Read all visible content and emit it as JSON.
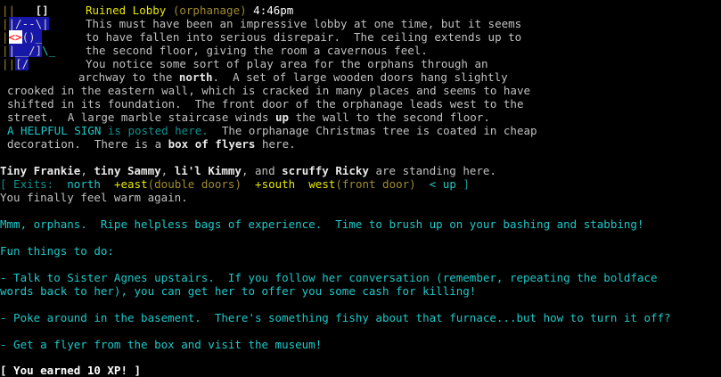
{
  "map": {
    "rows": [
      {
        "bar": "||",
        "room": "   []"
      },
      {
        "bar": "|",
        "room": "|/--\\|"
      },
      {
        "bar": "|",
        "player": "<>",
        "room": "()_"
      },
      {
        "bar": "|",
        "room": "|__/]",
        "tail": "\\_"
      },
      {
        "bar": "||",
        "room": "[/"
      }
    ],
    "colors": {
      "room_bg": "#1818a8",
      "player": "#ff3030",
      "bar": "#a08a30"
    }
  },
  "room": {
    "name": "Ruined Lobby",
    "area": "(orphanage)",
    "time": "4:46pm",
    "desc_lines": [
      [
        "This must have been an impressive lobby at one time, but it seems"
      ],
      [
        "to have fallen into serious disrepair.  The ceiling extends up to"
      ],
      [
        "the second floor, giving the room a cavernous feel."
      ],
      [
        "You notice some sort of play area for the orphans through an"
      ],
      [
        "archway to the ",
        "north",
        ".  A set of large wooden doors hang slightly"
      ],
      [
        "crooked in the eastern wall, which is cracked in many places and seems to have"
      ],
      [
        "shifted in its foundation.  The front door of the orphanage leads west to the"
      ],
      [
        "street.  A large marble staircase winds ",
        "up",
        " the wall to the second floor."
      ],
      [
        "A HELPFUL SIGN",
        " is posted here.",
        "  The orphanage Christmas tree is coated in cheap"
      ],
      [
        "decoration.  There is a ",
        "box of flyers",
        " here."
      ]
    ],
    "occupants": [
      "Tiny Frankie",
      ", ",
      "tiny Sammy",
      ", ",
      "li'l Kimmy",
      ", and ",
      "scruffy Ricky",
      " are standing here."
    ],
    "exits": {
      "open": "[ Exits:",
      "north": "north",
      "east_prefix": "+",
      "east": "east",
      "east_note": "(double doors)",
      "south": "+south",
      "west": "west",
      "west_note": "(front door)",
      "up": "< up",
      "close": "]"
    },
    "status": "You finally feel warm again."
  },
  "messages": {
    "intro": "Mmm, orphans.  Ripe helpless bags of experience.  Time to brush up on your bashing and stabbing!",
    "fun_header": "Fun things to do:",
    "tip1_line1": "- Talk to Sister Agnes upstairs.  If you follow her conversation (remember, repeating the boldface",
    "tip1_line2": "words back to her), you can get her to offer you some cash for killing!",
    "tip2": "- Poke around in the basement.  There's something fishy about that furnace...but how to turn it off?",
    "tip3": "- Get a flyer from the box and visit the museum!",
    "xp": "[ You earned 10 XP! ]"
  }
}
